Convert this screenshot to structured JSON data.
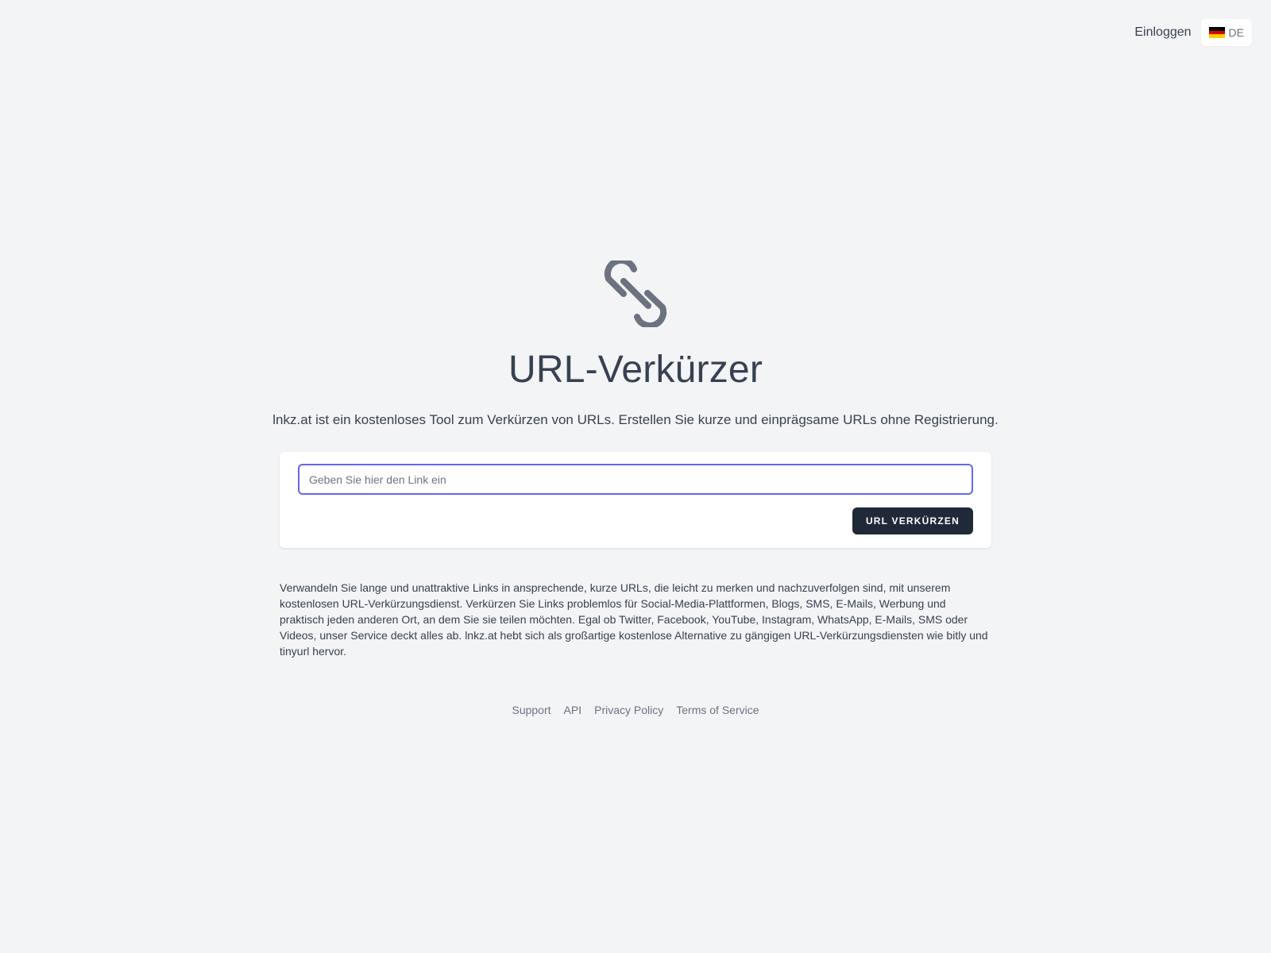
{
  "header": {
    "login_label": "Einloggen",
    "language": {
      "code": "DE",
      "flag": "german-flag",
      "flag_colors": [
        "#000000",
        "#dd0000",
        "#ffce00"
      ]
    }
  },
  "hero": {
    "icon": "link-icon",
    "title": "URL-Verkürzer",
    "subtitle": "lnkz.at ist ein kostenloses Tool zum Verkürzen von URLs. Erstellen Sie kurze und einprägsame URLs ohne Registrierung."
  },
  "shortener": {
    "input_placeholder": "Geben Sie hier den Link ein",
    "input_value": "",
    "submit_label": "URL verkürzen"
  },
  "description": "Verwandeln Sie lange und unattraktive Links in ansprechende, kurze URLs, die leicht zu merken und nachzuverfolgen sind, mit unserem kostenlosen URL-Verkürzungsdienst. Verkürzen Sie Links problemlos für Social-Media-Plattformen, Blogs, SMS, E-Mails, Werbung und praktisch jeden anderen Ort, an dem Sie sie teilen möchten. Egal ob Twitter, Facebook, YouTube, Instagram, WhatsApp, E-Mails, SMS oder Videos, unser Service deckt alles ab. lnkz.at hebt sich als großartige kostenlose Alternative zu gängigen URL-Verkürzungsdiensten wie bitly und tinyurl hervor.",
  "footer": {
    "links": [
      "Support",
      "API",
      "Privacy Policy",
      "Terms of Service"
    ]
  },
  "colors": {
    "background": "#f3f4f6",
    "accent": "#6366f1",
    "button": "#1f2937",
    "icon": "#6b7280"
  }
}
